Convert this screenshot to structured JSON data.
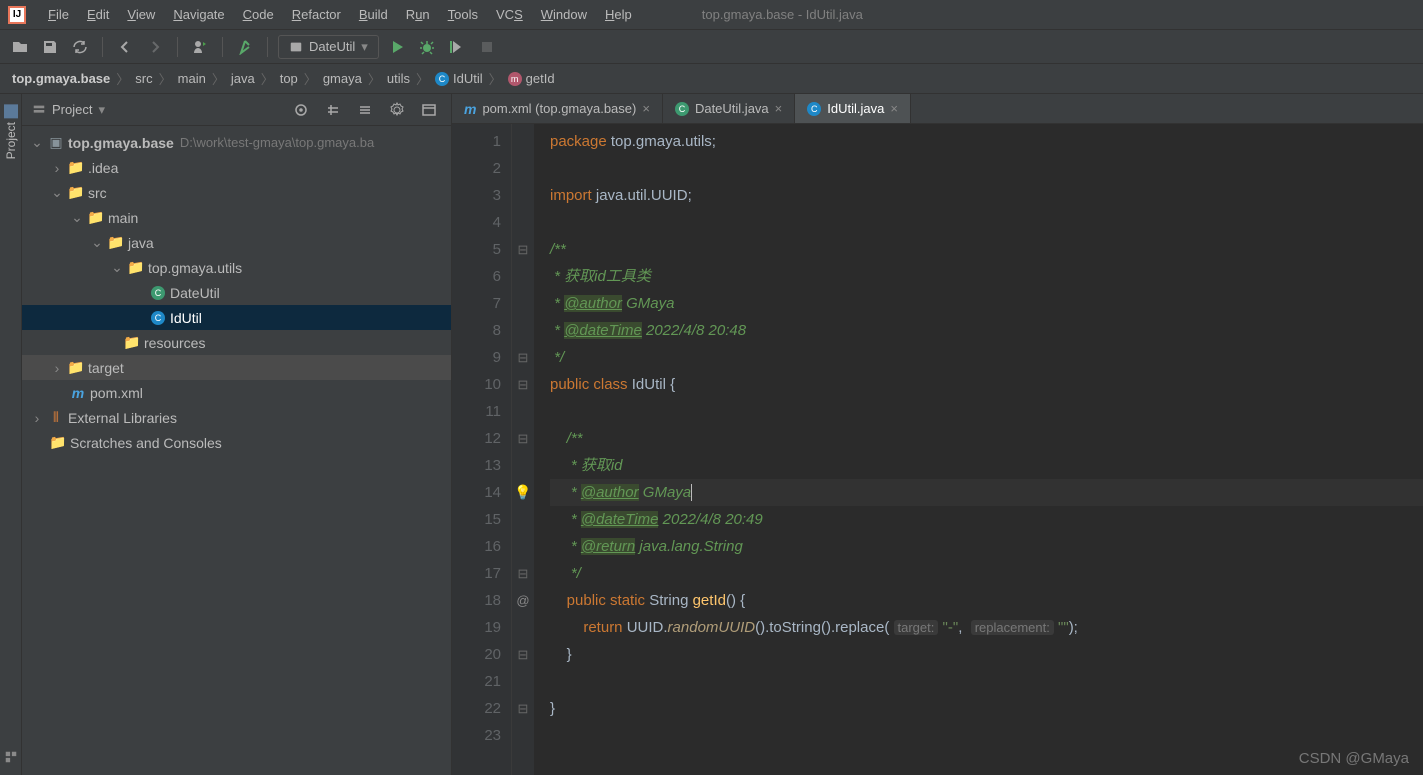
{
  "window": {
    "title": "top.gmaya.base - IdUtil.java"
  },
  "menu": {
    "file": "File",
    "edit": "Edit",
    "view": "View",
    "navigate": "Navigate",
    "code": "Code",
    "refactor": "Refactor",
    "build": "Build",
    "run": "Run",
    "tools": "Tools",
    "vcs": "VCS",
    "window": "Window",
    "help": "Help"
  },
  "toolbar": {
    "run_config": "DateUtil"
  },
  "breadcrumb": [
    "top.gmaya.base",
    "src",
    "main",
    "java",
    "top",
    "gmaya",
    "utils",
    "IdUtil",
    "getId"
  ],
  "left_tabs": {
    "project": "Project"
  },
  "project_panel": {
    "title": "Project",
    "root": "top.gmaya.base",
    "root_path": "D:\\work\\test-gmaya\\top.gmaya.ba",
    "idea": ".idea",
    "src": "src",
    "main": "main",
    "java": "java",
    "pkg": "top.gmaya.utils",
    "DateUtil": "DateUtil",
    "IdUtil": "IdUtil",
    "resources": "resources",
    "target": "target",
    "pom": "pom.xml",
    "ext": "External Libraries",
    "scratch": "Scratches and Consoles"
  },
  "tabs": [
    {
      "label": "pom.xml (top.gmaya.base)",
      "icon": "m"
    },
    {
      "label": "DateUtil.java",
      "icon": "c"
    },
    {
      "label": "IdUtil.java",
      "icon": "c",
      "active": true
    }
  ],
  "code": {
    "l1": {
      "pkg": "package",
      "ns": "top.gmaya.utils",
      "semi": ";"
    },
    "l3": {
      "imp": "import",
      "ns": "java.util.UUID",
      "semi": ";"
    },
    "l5": "/**",
    "l6": " * 获取id工具类",
    "l7": {
      "pre": " * ",
      "tag": "@author",
      "val": " GMaya"
    },
    "l8": {
      "pre": " * ",
      "tag": "@dateTime",
      "val": " 2022/4/8 20:48"
    },
    "l9": " */",
    "l10": {
      "pub": "public",
      "cls": "class",
      "name": "IdUtil",
      "brace": " {"
    },
    "l12": "    /**",
    "l13": "     * 获取id",
    "l14": {
      "pre": "     * ",
      "tag": "@author",
      "val": " GMaya"
    },
    "l15": {
      "pre": "     * ",
      "tag": "@dateTime",
      "val": " 2022/4/8 20:49"
    },
    "l16": {
      "pre": "     * ",
      "tag": "@return",
      "val": " java.lang.String"
    },
    "l17": "     */",
    "l18": {
      "pub": "public",
      "st": "static",
      "type": "String",
      "name": "getId",
      "paren": "() {"
    },
    "l19": {
      "ret": "return",
      "uuid": "UUID",
      "rand": "randomUUID",
      "ts": "toString",
      "rep": "replace",
      "h1": "target:",
      "s1": "\"-\"",
      "h2": "replacement:",
      "s2": "\"\"",
      "end": ");"
    },
    "l20": "    }",
    "l22": "}"
  },
  "line_numbers": [
    "1",
    "2",
    "3",
    "4",
    "5",
    "6",
    "7",
    "8",
    "9",
    "10",
    "11",
    "12",
    "13",
    "14",
    "15",
    "16",
    "17",
    "18",
    "19",
    "20",
    "21",
    "22",
    "23"
  ],
  "watermark": "CSDN @GMaya"
}
